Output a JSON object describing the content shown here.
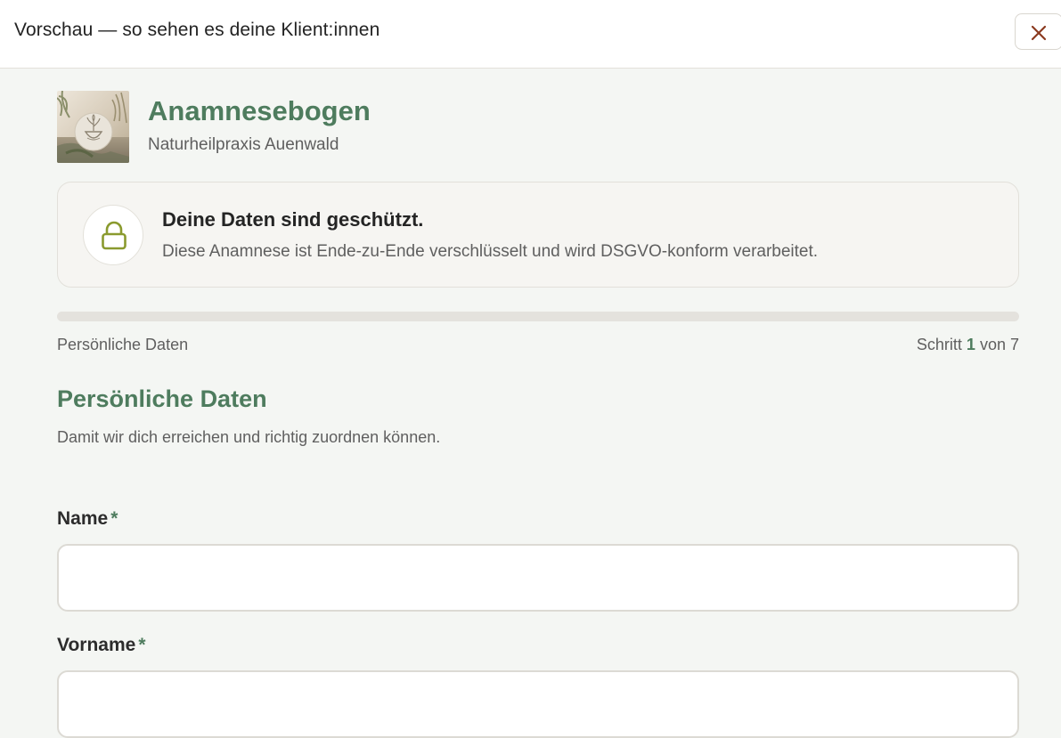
{
  "topbar": {
    "title": "Vorschau — so sehen es deine Klient:innen",
    "close_icon": "close-icon"
  },
  "header": {
    "image_icon": "plant-bowl-logo",
    "title": "Anamnesebogen",
    "practice": "Naturheilpraxis Auenwald"
  },
  "privacy": {
    "icon": "lock-icon",
    "heading": "Deine Daten sind geschützt.",
    "text": "Diese Anamnese ist Ende-zu-Ende verschlüsselt und wird DSGVO-konform verarbeitet."
  },
  "progress": {
    "fraction": 0,
    "step_name": "Persönliche Daten",
    "step_prefix": "Schritt",
    "current_step": "1",
    "step_separator": "von",
    "total_steps": "7"
  },
  "section": {
    "title": "Persönliche Daten",
    "description": "Damit wir dich erreichen und richtig zuordnen können."
  },
  "fields": [
    {
      "label": "Name",
      "required_marker": "*",
      "value": ""
    },
    {
      "label": "Vorname",
      "required_marker": "*",
      "value": ""
    }
  ],
  "colors": {
    "accent": "#4e7c5e",
    "lock_icon": "#8a9a2e",
    "close_icon": "#8b3a1f",
    "background": "#f4f6f3"
  }
}
